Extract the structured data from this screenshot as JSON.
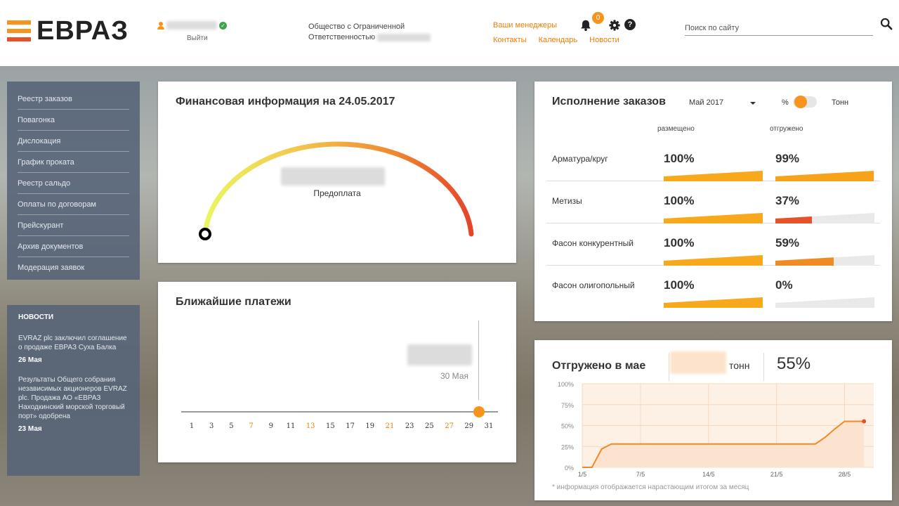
{
  "brand": {
    "logo_text": "ЕВРАЗ",
    "accent": "#f7941d",
    "accent_dark": "#e5522a"
  },
  "header": {
    "user_logout": "Выйти",
    "company_line1": "Общество с Ограниченной",
    "company_line2": "Ответственностью",
    "links": {
      "managers": "Ваши менеджеры",
      "contacts": "Контакты",
      "calendar": "Календарь",
      "news": "Новости"
    },
    "notification_count": "0",
    "help_glyph": "?",
    "search_placeholder": "Поиск по сайту",
    "icons": [
      "user-icon",
      "verified-icon",
      "bell-icon",
      "gear-icon",
      "help-icon",
      "search-icon"
    ]
  },
  "sidebar": {
    "items": [
      {
        "label": "Реестр заказов"
      },
      {
        "label": "Повагонка"
      },
      {
        "label": "Дислокация"
      },
      {
        "label": "График проката"
      },
      {
        "label": "Реестр сальдо"
      },
      {
        "label": "Оплаты по договорам"
      },
      {
        "label": "Прейскурант"
      },
      {
        "label": "Архив документов"
      },
      {
        "label": "Модерация заявок"
      }
    ]
  },
  "news": {
    "title": "НОВОСТИ",
    "items": [
      {
        "text": "EVRAZ plc заключил соглашение о продаже ЕВРАЗ Суха Балка",
        "date": "26 Мая"
      },
      {
        "text": "Результаты Общего собрания независимых акционеров EVRAZ plc. Продажа АО «ЕВРАЗ Находкинский морской торговый порт» одобрена",
        "date": "23 Мая"
      }
    ]
  },
  "finance": {
    "title": "Финансовая информация на 24.05.2017",
    "label": "Предоплата",
    "gauge_value_fraction": 0
  },
  "payments": {
    "title": "Ближайшие платежи",
    "date_label": "30 Мая",
    "days": [
      "1",
      "3",
      "5",
      "7",
      "9",
      "11",
      "13",
      "15",
      "17",
      "19",
      "21",
      "23",
      "25",
      "27",
      "29",
      "31"
    ],
    "weekend_days": [
      "7",
      "13",
      "21",
      "27"
    ],
    "selected_day": 30
  },
  "orders": {
    "title": "Исполнение заказов",
    "period": "Май 2017",
    "unit_percent": "%",
    "unit_tons": "Тонн",
    "col_placed": "размещено",
    "col_shipped": "отгружено",
    "rows": [
      {
        "name": "Арматура/круг",
        "placed": "100%",
        "shipped": "99%",
        "placed_frac": 1.0,
        "shipped_frac": 0.99,
        "shipped_color": "#f7a21b"
      },
      {
        "name": "Метизы",
        "placed": "100%",
        "shipped": "37%",
        "placed_frac": 1.0,
        "shipped_frac": 0.37,
        "shipped_color": "#e5522a"
      },
      {
        "name": "Фасон конкурентный",
        "placed": "100%",
        "shipped": "59%",
        "placed_frac": 1.0,
        "shipped_frac": 0.59,
        "shipped_color": "#f08a24"
      },
      {
        "name": "Фасон олигопольный",
        "placed": "100%",
        "shipped": "0%",
        "placed_frac": 1.0,
        "shipped_frac": 0.0,
        "shipped_color": "#f7a21b"
      }
    ]
  },
  "shipped": {
    "title": "Отгружено в мае",
    "unit": "тонн",
    "share": "55%",
    "note": "* информация отображается нарастающим итогом за месяц"
  },
  "chart_data": {
    "type": "area",
    "title": "Отгружено в мае",
    "x": [
      1,
      2,
      3,
      4,
      5,
      6,
      7,
      8,
      9,
      10,
      11,
      12,
      13,
      14,
      15,
      16,
      17,
      18,
      19,
      20,
      21,
      22,
      23,
      24,
      25,
      26,
      27,
      28,
      29,
      30
    ],
    "values": [
      0,
      0,
      22,
      28,
      28,
      28,
      28,
      28,
      28,
      28,
      28,
      28,
      28,
      28,
      28,
      28,
      28,
      28,
      28,
      28,
      28,
      28,
      28,
      28,
      28,
      36,
      46,
      55,
      55,
      55
    ],
    "xtick_labels": [
      "1/5",
      "7/5",
      "14/5",
      "21/5",
      "28/5"
    ],
    "xticks": [
      1,
      7,
      14,
      21,
      28
    ],
    "ytick_labels": [
      "0%",
      "25%",
      "50%",
      "75%",
      "100%"
    ],
    "yticks": [
      0,
      25,
      50,
      75,
      100
    ],
    "xlim": [
      1,
      31
    ],
    "ylim": [
      0,
      100
    ],
    "grid": true,
    "color": "#f08a24",
    "fill": "#fbe3cf"
  }
}
